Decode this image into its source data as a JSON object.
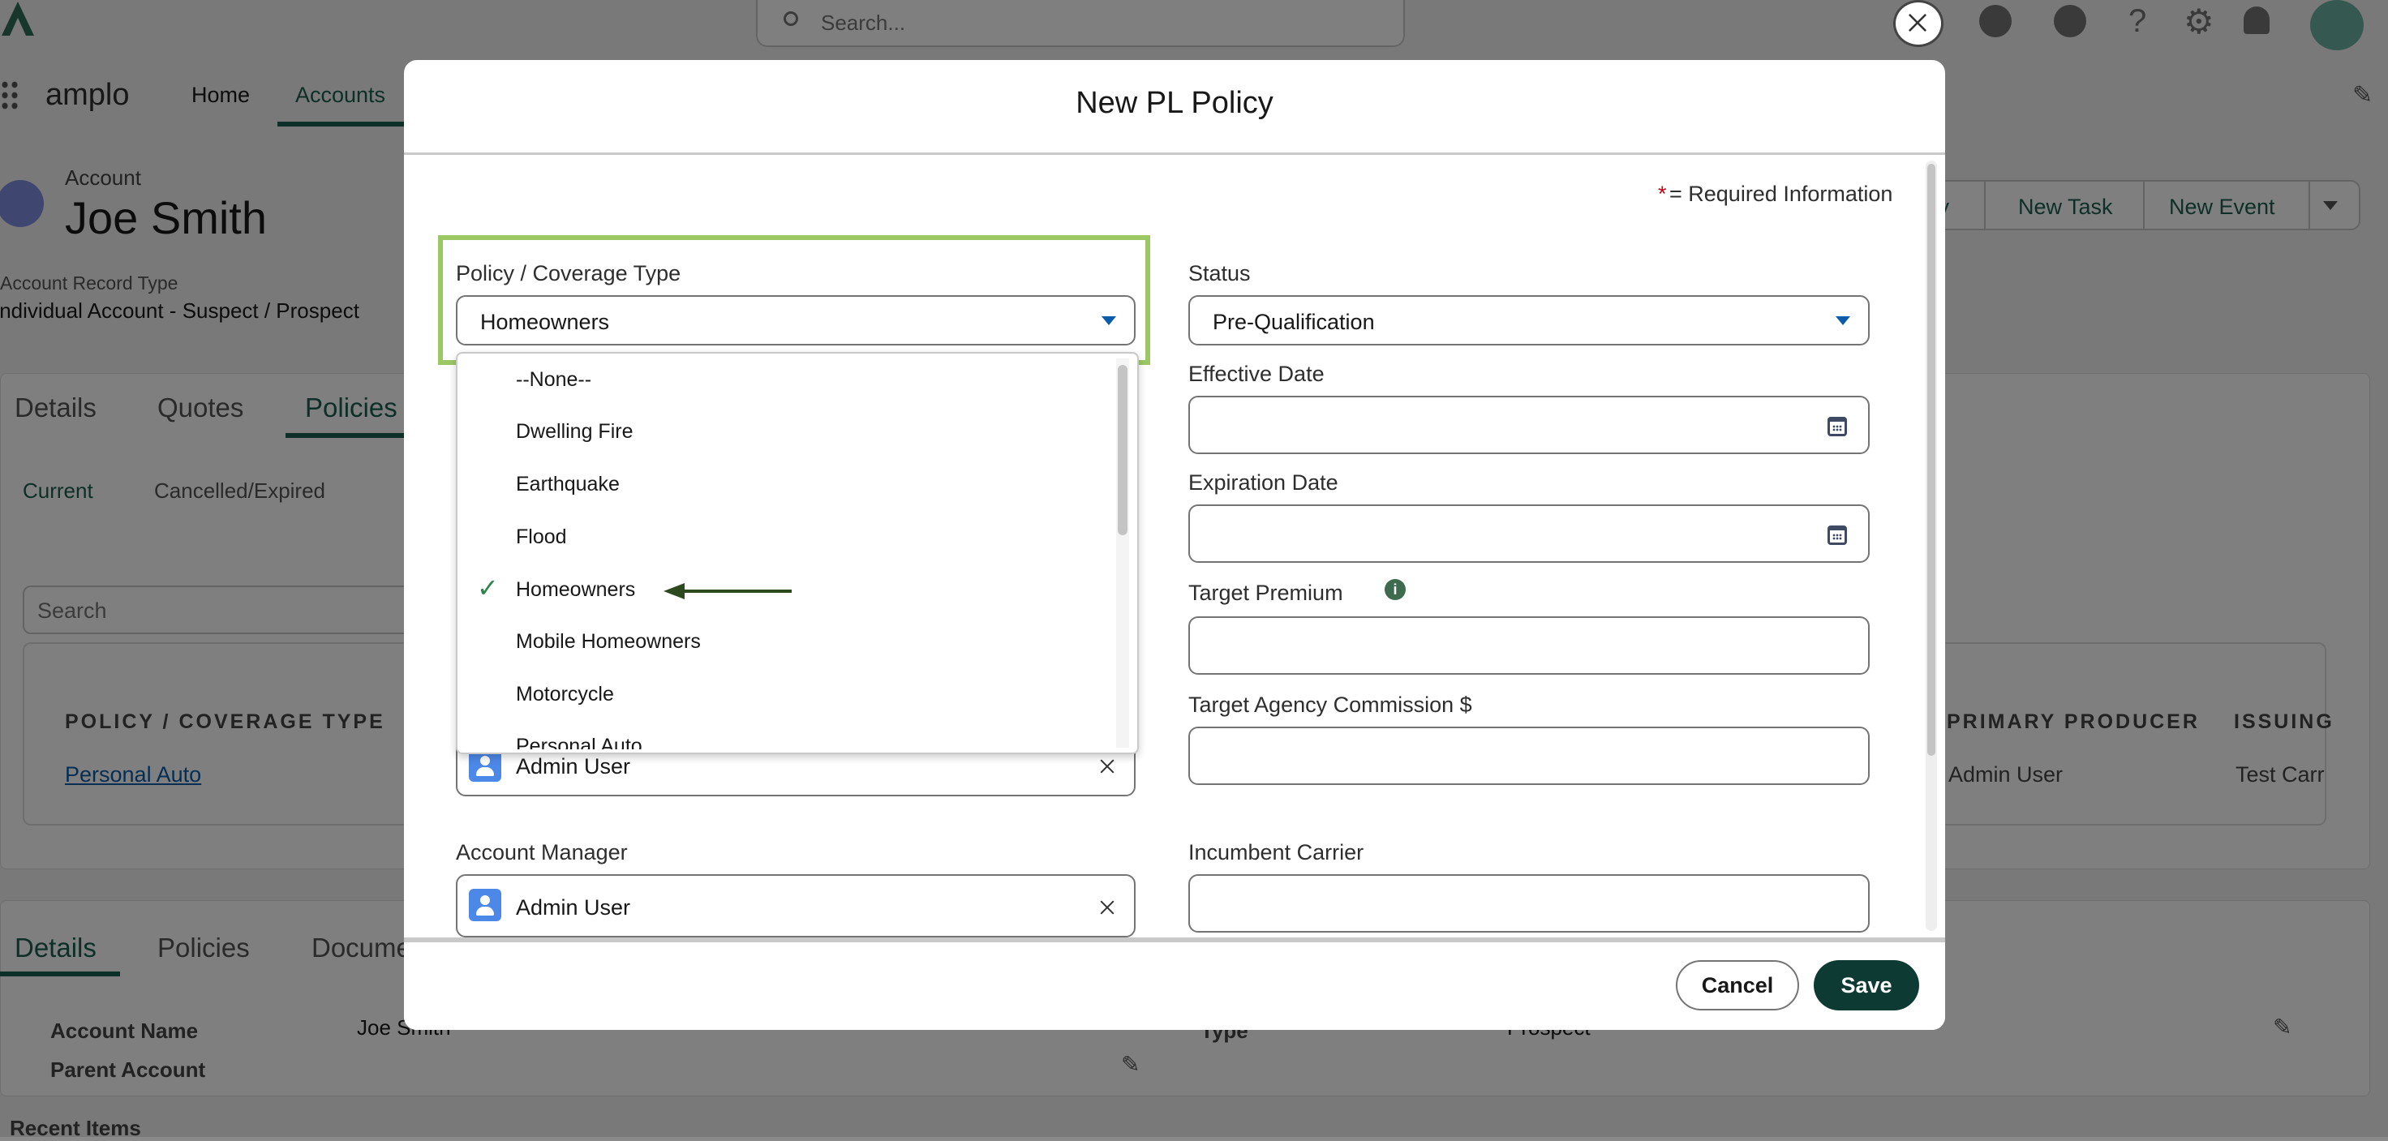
{
  "global_header": {
    "search_placeholder": "Search..."
  },
  "nav": {
    "app_name": "amplo",
    "items": [
      {
        "label": "Home"
      },
      {
        "label": "Accounts"
      }
    ]
  },
  "account": {
    "object_label": "Account",
    "name": "Joe Smith",
    "record_type_label": "Account Record Type",
    "record_type_value": "Individual Account - Suspect / Prospect",
    "actions": [
      "cy",
      "New Task",
      "New Event"
    ]
  },
  "tabs_upper": [
    "Details",
    "Quotes",
    "Policies"
  ],
  "subtabs": [
    "Current",
    "Cancelled/Expired"
  ],
  "list": {
    "search_placeholder": "Search",
    "col_policy": "POLICY / COVERAGE TYPE",
    "col_producer": "PRIMARY PRODUCER",
    "col_issuing": "ISSUING",
    "row_policy": "Personal Auto",
    "row_producer": "Admin User",
    "row_issuing": "Test Carr"
  },
  "tabs_lower": [
    "Details",
    "Policies",
    "Docume"
  ],
  "details": {
    "account_name_label": "Account Name",
    "account_name_value": "Joe Smith",
    "parent_label": "Parent Account",
    "type_label": "Type",
    "type_value": "Prospect"
  },
  "recent_items": "Recent Items",
  "modal": {
    "title": "New PL Policy",
    "required_star": "*",
    "required_text": "= Required Information",
    "policy_type": {
      "label": "Policy / Coverage Type",
      "value": "Homeowners",
      "options": [
        "--None--",
        "Dwelling Fire",
        "Earthquake",
        "Flood",
        "Homeowners",
        "Mobile Homeowners",
        "Motorcycle",
        "Personal Auto"
      ],
      "selected_index": 4
    },
    "status": {
      "label": "Status",
      "value": "Pre-Qualification"
    },
    "effective_date": {
      "label": "Effective Date",
      "value": ""
    },
    "expiration_date": {
      "label": "Expiration Date",
      "value": ""
    },
    "target_premium": {
      "label": "Target Premium",
      "value": ""
    },
    "target_commission": {
      "label": "Target Agency Commission $",
      "value": ""
    },
    "producer_value": "Admin User",
    "account_manager": {
      "label": "Account Manager",
      "value": "Admin User"
    },
    "incumbent_carrier": {
      "label": "Incumbent Carrier",
      "value": ""
    },
    "cancel_label": "Cancel",
    "save_label": "Save"
  },
  "colors": {
    "highlight_box": "#9bc765",
    "save_button": "#0d3b34",
    "annotation_arrow": "#2d4a1f",
    "dropdown_caret": "#0b5cab"
  }
}
